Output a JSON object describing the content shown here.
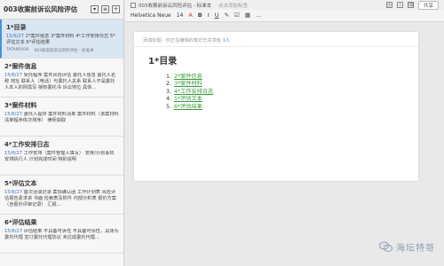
{
  "notebook": {
    "title": "003收案前诉讼风险评估"
  },
  "notes": [
    {
      "title": "1*目录",
      "date": "15/6/27",
      "snippet": "2*案件信息 3*案件材料 4*工作安排日志 5*评估文本 6*评估结果",
      "meta_user": "TATAN5939",
      "meta_nb": "003收案前诉讼风险评估 - 标准本"
    },
    {
      "title": "2*案件信息",
      "date": "15/6/27",
      "snippet": "受托程序 案件风险评估 委托人信息 委托人名称 地址 联系人（电话）与委托人关系 联系人不是委托人本人的则需写 授权委托书 诉讼地位 具体..."
    },
    {
      "title": "3*案件材料",
      "date": "15/6/27",
      "snippet": "委托人提供 案件材料清单 案件材料（该案材料清单程序依次排序） 律师获取"
    },
    {
      "title": "4*工作安排日志",
      "date": "15/6/27",
      "snippet": "工作安排（案件管理人填写） 安排/计划事项 安排执行人 计划完成时间 特别说明"
    },
    {
      "title": "5*评估文本",
      "date": "15/6/27",
      "snippet": "首次洽谈记录 案情确认函 工作计划表 风险评估报告素求资 书面 检索表及附件 内部分析表 报价方案（含报价评审记录） 汇报..."
    },
    {
      "title": "6*评估结果",
      "date": "15/6/27",
      "snippet": "评估结果 不具备可诉性 不具备可诉性，具体为 委托代理 签订委托代理协议 未达成委托代理..."
    }
  ],
  "editor": {
    "breadcrumb": "003收案前诉讼风险评估 - 标准本",
    "reminder_label": "点击添加标签",
    "font_name": "Helvetica Neue",
    "font_size": "14",
    "share_label": "共享",
    "hint_text": "添加标题 · 你正在编辑的笔记已共享给",
    "hint_link": "1人",
    "doc_title": "1*目录",
    "toc": [
      {
        "num": "1.",
        "label": "2*案件信息"
      },
      {
        "num": "2.",
        "label": "3*案件材料"
      },
      {
        "num": "3.",
        "label": "4*工作安排日志"
      },
      {
        "num": "4.",
        "label": "5*评估文本"
      },
      {
        "num": "5.",
        "label": "6*评估结果"
      }
    ]
  },
  "watermark": {
    "text": "海坛特哥",
    "icon": "wechat-icon"
  }
}
